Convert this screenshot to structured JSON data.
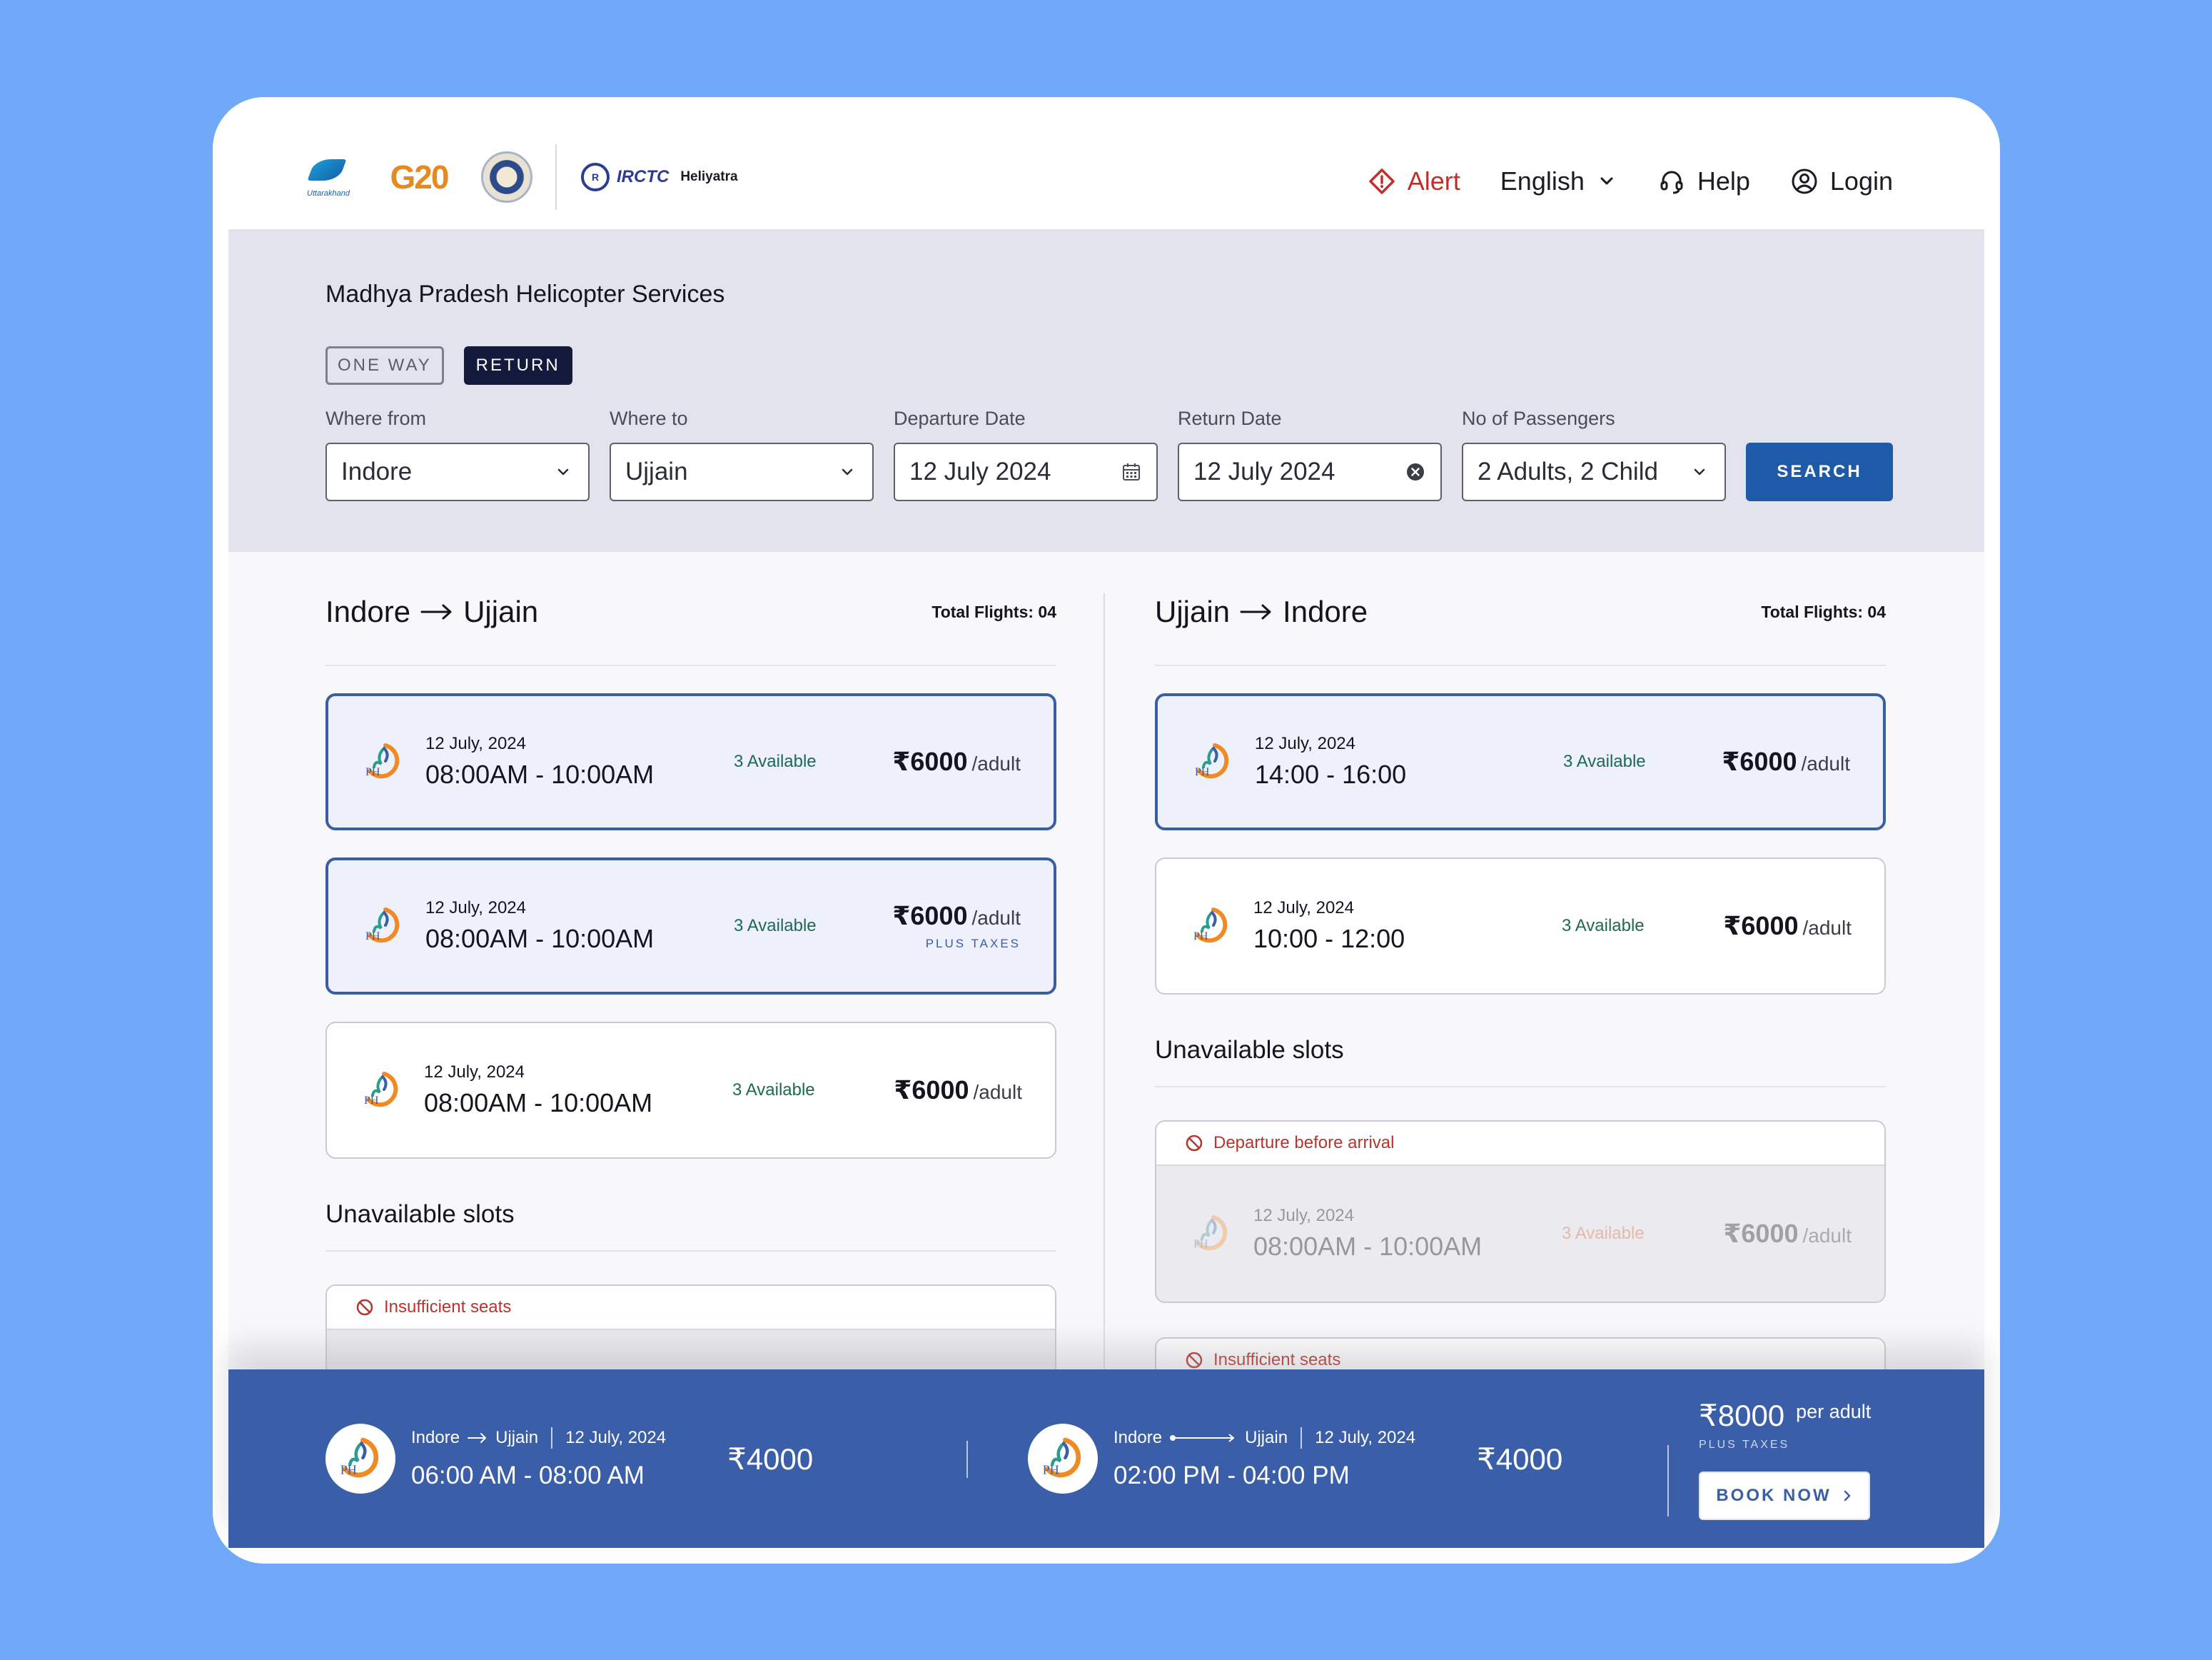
{
  "header": {
    "logos": {
      "uttarakhand": "Uttarakhand",
      "g20": "G20",
      "irctc": "IRCTC",
      "heliyatra": "Heliyatra"
    },
    "nav": {
      "alert": "Alert",
      "language": "English",
      "help": "Help",
      "login": "Login"
    }
  },
  "search": {
    "title": "Madhya Pradesh Helicopter Services",
    "trip_types": [
      "ONE WAY",
      "RETURN"
    ],
    "selected_trip": "RETURN",
    "fields": {
      "from_label": "Where from",
      "from_value": "Indore",
      "to_label": "Where to",
      "to_value": "Ujjain",
      "departure_label": "Departure Date",
      "departure_value": "12 July 2024",
      "return_label": "Return Date",
      "return_value": "12 July 2024",
      "passengers_label": "No of Passengers",
      "passengers_value": "2 Adults, 2 Child"
    },
    "search_button": "SEARCH"
  },
  "outbound": {
    "from": "Indore",
    "to": "Ujjain",
    "total_flights": "Total Flights: 04",
    "flights": [
      {
        "date": "12 July, 2024",
        "time": "08:00AM - 10:00AM",
        "availability": "3 Available",
        "price": "₹6000",
        "unit": "/adult",
        "note": ""
      },
      {
        "date": "12 July, 2024",
        "time": "08:00AM - 10:00AM",
        "availability": "3 Available",
        "price": "₹6000",
        "unit": "/adult",
        "note": "PLUS TAXES"
      },
      {
        "date": "12 July, 2024",
        "time": "08:00AM - 10:00AM",
        "availability": "3 Available",
        "price": "₹6000",
        "unit": "/adult",
        "note": ""
      }
    ],
    "unavailable_title": "Unavailable slots",
    "unavailable": [
      {
        "reason": "Insufficient seats"
      }
    ]
  },
  "return": {
    "from": "Ujjain",
    "to": "Indore",
    "total_flights": "Total Flights: 04",
    "flights": [
      {
        "date": "12 July, 2024",
        "time": "14:00 - 16:00",
        "availability": "3 Available",
        "price": "₹6000",
        "unit": "/adult"
      },
      {
        "date": "12 July, 2024",
        "time": "10:00 - 12:00",
        "availability": "3 Available",
        "price": "₹6000",
        "unit": "/adult"
      }
    ],
    "unavailable_title": "Unavailable slots",
    "unavailable": [
      {
        "reason": "Departure before arrival",
        "date": "12 July, 2024",
        "time": "08:00AM - 10:00AM",
        "availability": "3 Available",
        "price": "₹6000",
        "unit": "/adult"
      },
      {
        "reason": "Insufficient seats"
      }
    ]
  },
  "summary": {
    "outbound": {
      "from": "Indore",
      "to": "Ujjain",
      "date": "12 July, 2024",
      "time": "06:00 AM - 08:00 AM",
      "price": "₹4000"
    },
    "return": {
      "from": "Indore",
      "to": "Ujjain",
      "date": "12 July, 2024",
      "time": "02:00 PM - 04:00 PM",
      "price": "₹4000"
    },
    "total": "₹8000",
    "total_unit": "per adult",
    "taxes": "PLUS TAXES",
    "book_button": "BOOK NOW"
  },
  "colors": {
    "background": "#6fa9f7",
    "primary": "#1f5aa8",
    "bottom_bar": "#3a5ea8",
    "alert": "#c0302a",
    "available": "#1d6a54"
  }
}
